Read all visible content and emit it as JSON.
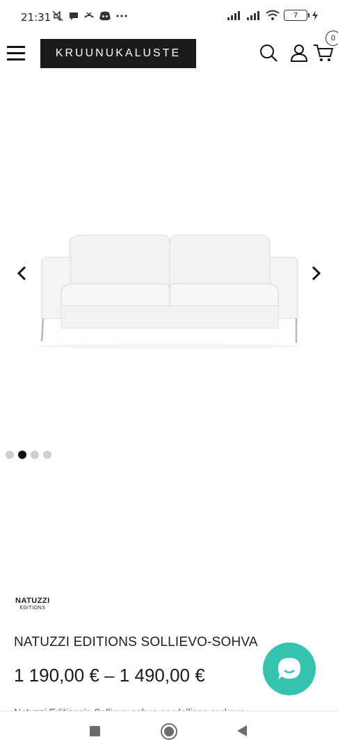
{
  "status_bar": {
    "time": "21:31",
    "battery_level": "7"
  },
  "header": {
    "logo_text": "KRUUNUKALUSTE",
    "cart_count": "0"
  },
  "gallery": {
    "image_alt": "white leather sofa",
    "slides": 4,
    "active_slide": 2
  },
  "product": {
    "brand_main": "NATUZZI",
    "brand_sub": "EDITIONS",
    "title": "NATUZZI EDITIONS SOLLIEVO-SOHVA",
    "price": "1 190,00 € – 1 490,00 €",
    "description_peek": "Natuzzi Editionsin Sollievo-sohva on ylellisen mukava"
  },
  "colors": {
    "chat_accent": "#35c2b1",
    "logo_bg": "#1b1b1b"
  }
}
